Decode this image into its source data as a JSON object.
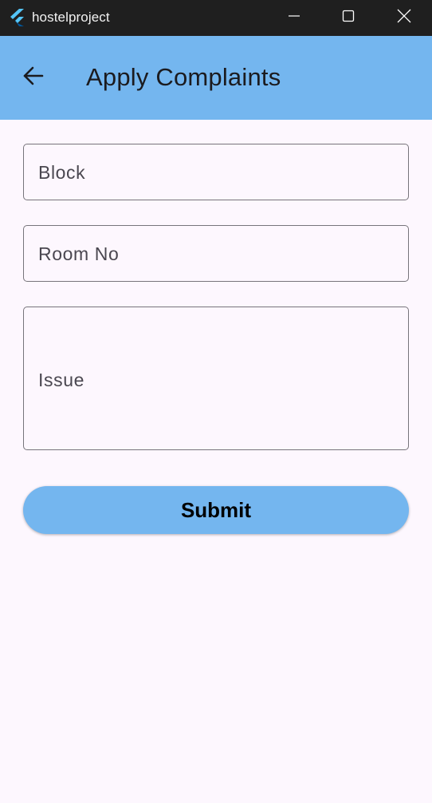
{
  "window": {
    "title": "hostelproject",
    "controls": [
      "minimize-icon",
      "maximize-icon",
      "close-icon"
    ]
  },
  "appbar": {
    "back_icon": "arrow-left-icon",
    "title": "Apply Complaints",
    "background": "#74b6ef"
  },
  "form": {
    "block": {
      "placeholder": "Block",
      "value": ""
    },
    "room_no": {
      "placeholder": "Room No",
      "value": ""
    },
    "issue": {
      "placeholder": "Issue",
      "value": ""
    },
    "submit_label": "Submit"
  },
  "colors": {
    "accent": "#74b6ef",
    "page_background": "#fdf7fe",
    "titlebar": "#1f1f1f"
  }
}
